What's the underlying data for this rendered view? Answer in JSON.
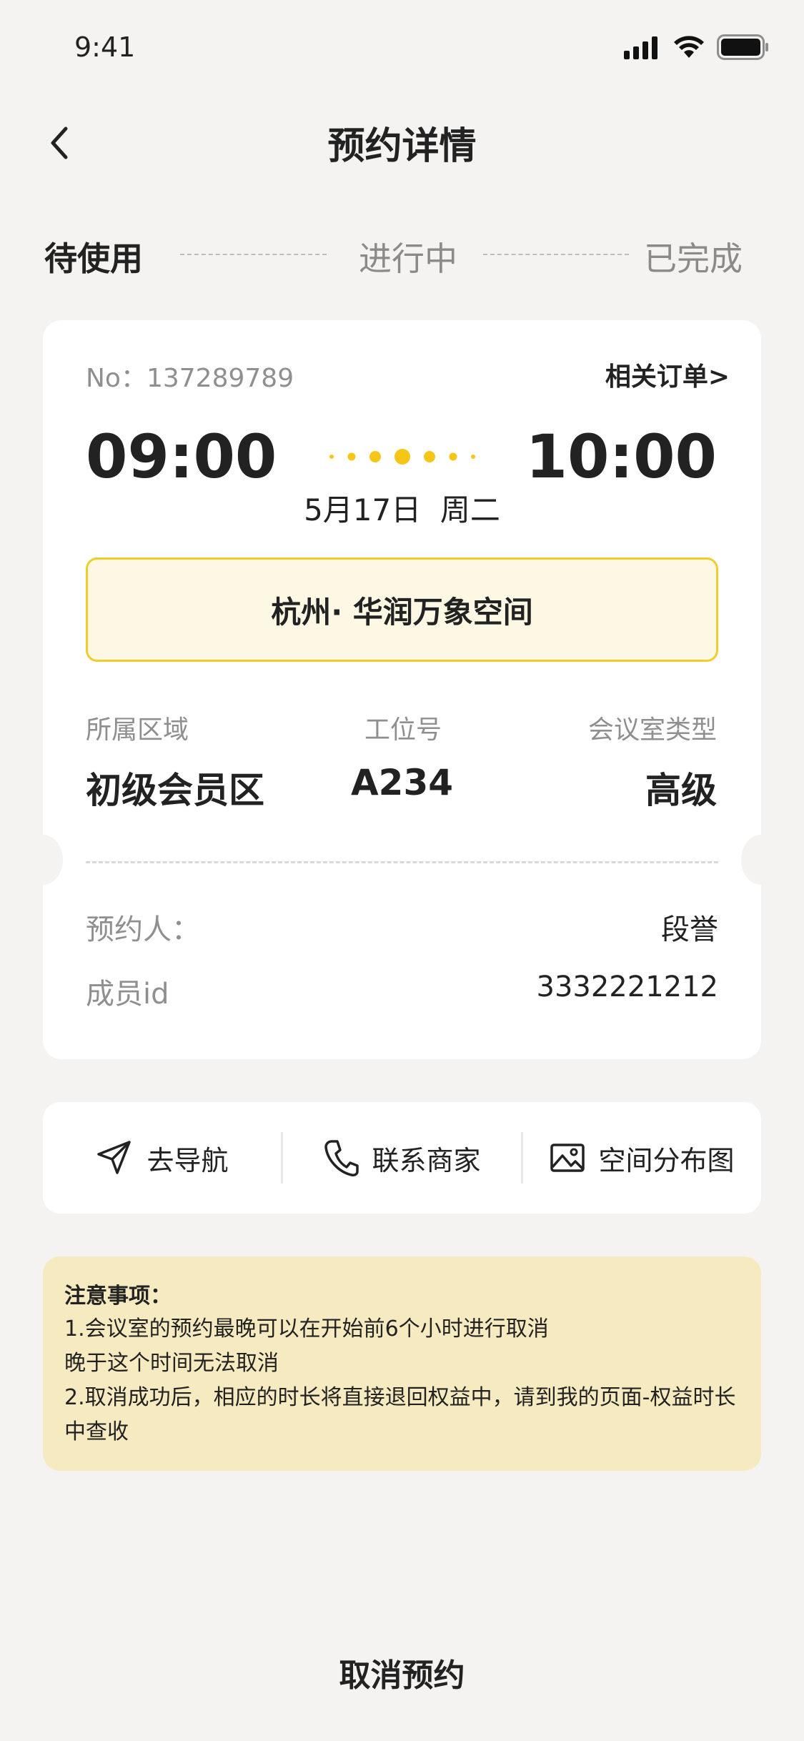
{
  "status_bar": {
    "time": "9:41"
  },
  "header": {
    "title": "预约详情"
  },
  "steps": [
    "待使用",
    "进行中",
    "已完成"
  ],
  "ticket": {
    "order_no": "No：137289789",
    "related_link": "相关订单>",
    "start_time": "09:00",
    "end_time": "10:00",
    "date": "5月17日  周二",
    "place": "杭州· 华润万象空间",
    "labels": {
      "area": "所属区域",
      "seat": "工位号",
      "type": "会议室类型"
    },
    "values": {
      "area": "初级会员区",
      "seat": "A234",
      "type": "高级"
    },
    "booker_label": "预约人：",
    "booker": "段誉",
    "member_label": "成员id",
    "member_id": "3332221212"
  },
  "actions": {
    "navigate": "去导航",
    "contact": "联系商家",
    "map": "空间分布图"
  },
  "notice": {
    "title": "注意事项：",
    "lines": [
      "1.会议室的预约最晚可以在开始前6个小时进行取消",
      "晚于这个时间无法取消",
      "2.取消成功后，相应的时长将直接退回权益中，请到我的页面-权益时长",
      "中查收"
    ]
  },
  "cancel_label": "取消预约",
  "colors": {
    "accent": "#f5c518",
    "background": "#f4f3f1",
    "notice_bg": "#f6ebc0",
    "place_border": "#f0cd2a"
  }
}
